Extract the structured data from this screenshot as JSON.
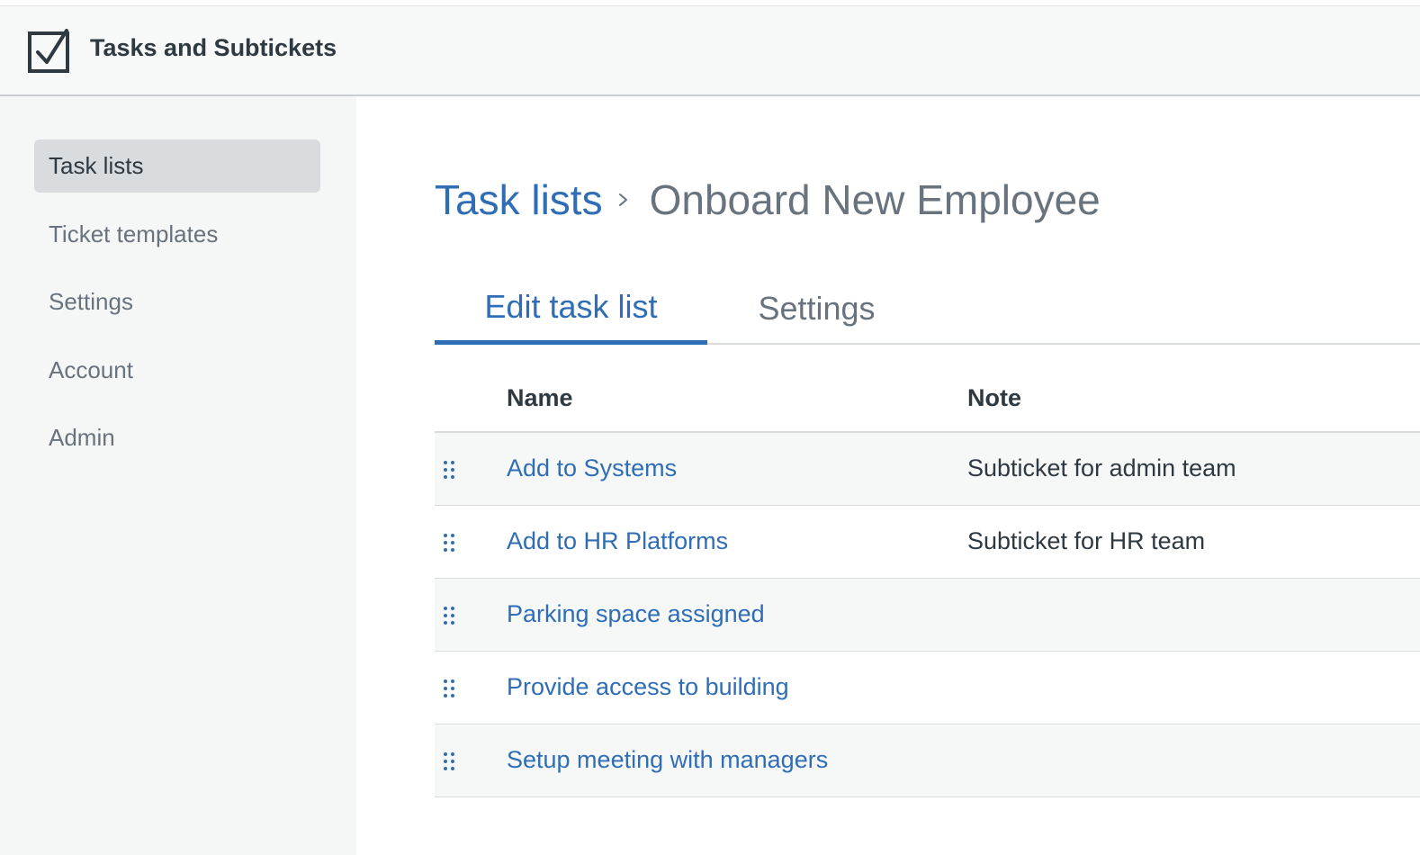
{
  "header": {
    "title": "Tasks and Subtickets",
    "logo_icon": "checkbox-icon"
  },
  "sidebar": {
    "items": [
      {
        "label": "Task lists",
        "active": true
      },
      {
        "label": "Ticket templates",
        "active": false
      },
      {
        "label": "Settings",
        "active": false
      },
      {
        "label": "Account",
        "active": false
      },
      {
        "label": "Admin",
        "active": false
      }
    ]
  },
  "breadcrumb": {
    "parent": "Task lists",
    "separator_icon": "chevron-right-icon",
    "current": "Onboard New Employee"
  },
  "tabs": [
    {
      "label": "Edit task list",
      "active": true
    },
    {
      "label": "Settings",
      "active": false
    }
  ],
  "table": {
    "columns": [
      "Name",
      "Note"
    ],
    "rows": [
      {
        "name": "Add to Systems",
        "note": "Subticket for admin team"
      },
      {
        "name": "Add to HR Platforms",
        "note": "Subticket for HR team"
      },
      {
        "name": "Parking space assigned",
        "note": ""
      },
      {
        "name": "Provide access to building",
        "note": ""
      },
      {
        "name": "Setup meeting with managers",
        "note": ""
      }
    ],
    "drag_icon": "drag-handle-icon"
  },
  "colors": {
    "accent": "#2f6db5",
    "text": "#2f3941",
    "muted": "#68737d"
  }
}
